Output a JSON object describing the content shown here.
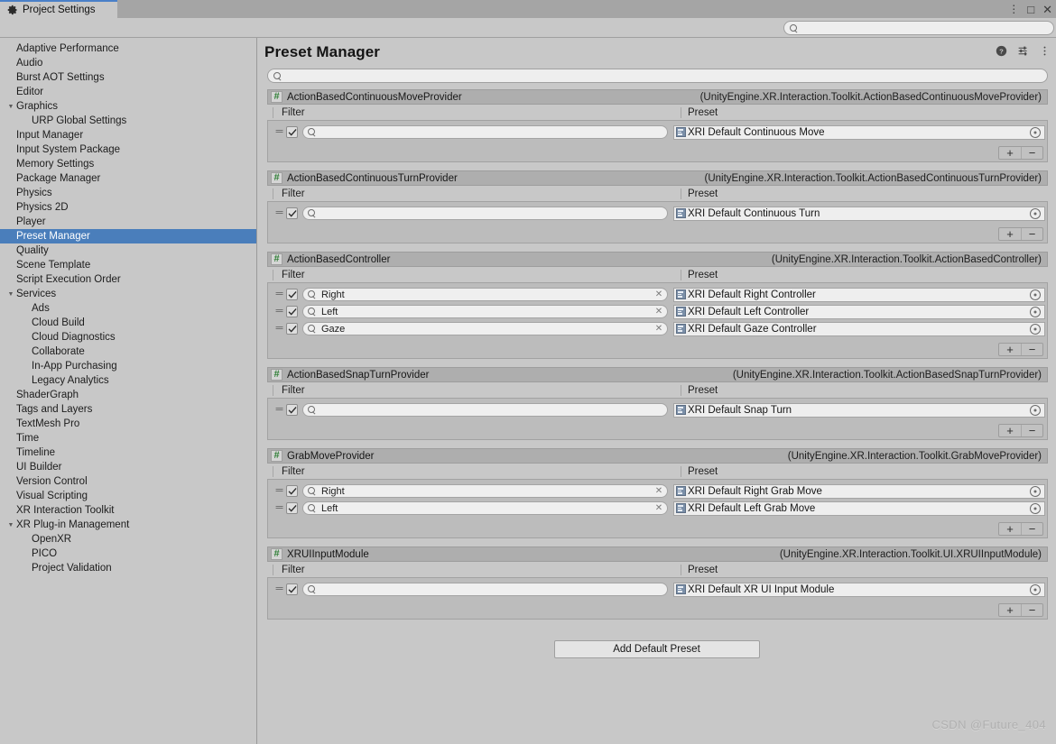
{
  "window": {
    "tab_title": "Project Settings",
    "tab_icon": "gear-icon",
    "controls": {
      "menu": "⋮",
      "maximize": "□",
      "close": "✕"
    }
  },
  "global_search": {
    "value": "",
    "placeholder": ""
  },
  "sidebar": {
    "items": [
      {
        "label": "Adaptive Performance",
        "depth": 0,
        "expandable": false,
        "selected": false
      },
      {
        "label": "Audio",
        "depth": 0,
        "expandable": false,
        "selected": false
      },
      {
        "label": "Burst AOT Settings",
        "depth": 0,
        "expandable": false,
        "selected": false
      },
      {
        "label": "Editor",
        "depth": 0,
        "expandable": false,
        "selected": false
      },
      {
        "label": "Graphics",
        "depth": 0,
        "expandable": true,
        "selected": false
      },
      {
        "label": "URP Global Settings",
        "depth": 1,
        "expandable": false,
        "selected": false
      },
      {
        "label": "Input Manager",
        "depth": 0,
        "expandable": false,
        "selected": false
      },
      {
        "label": "Input System Package",
        "depth": 0,
        "expandable": false,
        "selected": false
      },
      {
        "label": "Memory Settings",
        "depth": 0,
        "expandable": false,
        "selected": false
      },
      {
        "label": "Package Manager",
        "depth": 0,
        "expandable": false,
        "selected": false
      },
      {
        "label": "Physics",
        "depth": 0,
        "expandable": false,
        "selected": false
      },
      {
        "label": "Physics 2D",
        "depth": 0,
        "expandable": false,
        "selected": false
      },
      {
        "label": "Player",
        "depth": 0,
        "expandable": false,
        "selected": false
      },
      {
        "label": "Preset Manager",
        "depth": 0,
        "expandable": false,
        "selected": true
      },
      {
        "label": "Quality",
        "depth": 0,
        "expandable": false,
        "selected": false
      },
      {
        "label": "Scene Template",
        "depth": 0,
        "expandable": false,
        "selected": false
      },
      {
        "label": "Script Execution Order",
        "depth": 0,
        "expandable": false,
        "selected": false
      },
      {
        "label": "Services",
        "depth": 0,
        "expandable": true,
        "selected": false
      },
      {
        "label": "Ads",
        "depth": 1,
        "expandable": false,
        "selected": false
      },
      {
        "label": "Cloud Build",
        "depth": 1,
        "expandable": false,
        "selected": false
      },
      {
        "label": "Cloud Diagnostics",
        "depth": 1,
        "expandable": false,
        "selected": false
      },
      {
        "label": "Collaborate",
        "depth": 1,
        "expandable": false,
        "selected": false
      },
      {
        "label": "In-App Purchasing",
        "depth": 1,
        "expandable": false,
        "selected": false
      },
      {
        "label": "Legacy Analytics",
        "depth": 1,
        "expandable": false,
        "selected": false
      },
      {
        "label": "ShaderGraph",
        "depth": 0,
        "expandable": false,
        "selected": false
      },
      {
        "label": "Tags and Layers",
        "depth": 0,
        "expandable": false,
        "selected": false
      },
      {
        "label": "TextMesh Pro",
        "depth": 0,
        "expandable": false,
        "selected": false
      },
      {
        "label": "Time",
        "depth": 0,
        "expandable": false,
        "selected": false
      },
      {
        "label": "Timeline",
        "depth": 0,
        "expandable": false,
        "selected": false
      },
      {
        "label": "UI Builder",
        "depth": 0,
        "expandable": false,
        "selected": false
      },
      {
        "label": "Version Control",
        "depth": 0,
        "expandable": false,
        "selected": false
      },
      {
        "label": "Visual Scripting",
        "depth": 0,
        "expandable": false,
        "selected": false
      },
      {
        "label": "XR Interaction Toolkit",
        "depth": 0,
        "expandable": false,
        "selected": false
      },
      {
        "label": "XR Plug-in Management",
        "depth": 0,
        "expandable": true,
        "selected": false
      },
      {
        "label": "OpenXR",
        "depth": 1,
        "expandable": false,
        "selected": false
      },
      {
        "label": "PICO",
        "depth": 1,
        "expandable": false,
        "selected": false
      },
      {
        "label": "Project Validation",
        "depth": 1,
        "expandable": false,
        "selected": false
      }
    ]
  },
  "main": {
    "title": "Preset Manager",
    "header_icons": [
      "help-icon",
      "preset-icon",
      "more-menu-icon"
    ],
    "panel_search": {
      "value": "",
      "placeholder": ""
    },
    "column_headers": {
      "filter": "Filter",
      "preset": "Preset"
    },
    "add_default_preset_label": "Add Default Preset",
    "plus_label": "+",
    "minus_label": "−",
    "groups": [
      {
        "type": "ActionBasedContinuousMoveProvider",
        "fullname": "(UnityEngine.XR.Interaction.Toolkit.ActionBasedContinuousMoveProvider)",
        "rows": [
          {
            "enabled": true,
            "filter": "",
            "filter_placeholder": "",
            "preset": "XRI Default Continuous Move"
          }
        ]
      },
      {
        "type": "ActionBasedContinuousTurnProvider",
        "fullname": "(UnityEngine.XR.Interaction.Toolkit.ActionBasedContinuousTurnProvider)",
        "rows": [
          {
            "enabled": true,
            "filter": "",
            "filter_placeholder": "",
            "preset": "XRI Default Continuous Turn"
          }
        ]
      },
      {
        "type": "ActionBasedController",
        "fullname": "(UnityEngine.XR.Interaction.Toolkit.ActionBasedController)",
        "rows": [
          {
            "enabled": true,
            "filter": "Right",
            "filter_placeholder": "",
            "preset": "XRI Default Right Controller"
          },
          {
            "enabled": true,
            "filter": "Left",
            "filter_placeholder": "",
            "preset": "XRI Default Left Controller"
          },
          {
            "enabled": true,
            "filter": "Gaze",
            "filter_placeholder": "",
            "preset": "XRI Default Gaze Controller"
          }
        ]
      },
      {
        "type": "ActionBasedSnapTurnProvider",
        "fullname": "(UnityEngine.XR.Interaction.Toolkit.ActionBasedSnapTurnProvider)",
        "rows": [
          {
            "enabled": true,
            "filter": "",
            "filter_placeholder": "",
            "preset": "XRI Default Snap Turn"
          }
        ]
      },
      {
        "type": "GrabMoveProvider",
        "fullname": "(UnityEngine.XR.Interaction.Toolkit.GrabMoveProvider)",
        "rows": [
          {
            "enabled": true,
            "filter": "Right",
            "filter_placeholder": "",
            "preset": "XRI Default Right Grab Move"
          },
          {
            "enabled": true,
            "filter": "Left",
            "filter_placeholder": "",
            "preset": "XRI Default Left Grab Move"
          }
        ]
      },
      {
        "type": "XRUIInputModule",
        "fullname": "(UnityEngine.XR.Interaction.Toolkit.UI.XRUIInputModule)",
        "rows": [
          {
            "enabled": true,
            "filter": "",
            "filter_placeholder": "",
            "preset": "XRI Default XR UI Input Module"
          }
        ]
      }
    ]
  },
  "watermark": "CSDN @Future_404",
  "colors": {
    "window_bg": "#c8c8c8",
    "titlebar": "#a5a5a5",
    "tab_accent": "#4a80c8",
    "selection": "#4a7ebb",
    "group_header": "#aeaeae",
    "row_area": "#bcbcbc",
    "field_bg": "#eeeeee",
    "cs_green": "#2f7f36"
  }
}
